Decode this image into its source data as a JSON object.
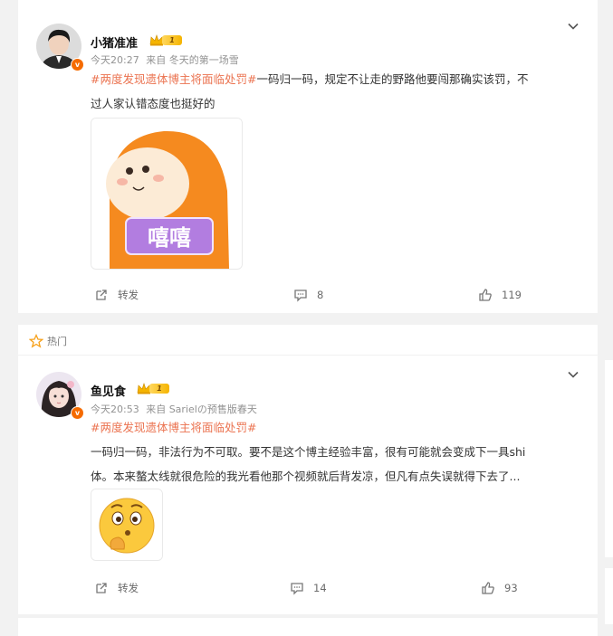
{
  "feed": {
    "hot_label": "热门",
    "posts": [
      {
        "username": "小猪准准",
        "level": "1",
        "time": "今天20:27",
        "source": "来自 冬天的第一场雪",
        "topic": "#两度发现遗体博主将面临处罚#",
        "text_line1_rest": "一码归一码，规定不让走的野路他要闯那确实该罚，不",
        "text_line2": "过人家认错态度也挺好的",
        "image_caption": "嘻嘻",
        "actions": {
          "repost": "转发",
          "comments": "8",
          "likes": "119"
        }
      },
      {
        "username": "鱼见食",
        "level": "1",
        "time": "今天20:53",
        "source": "来自 Sarielの预售版春天",
        "topic": "#两度发现遗体博主将面临处罚#",
        "text_line1": "一码归一码，非法行为不可取。要不是这个博主经验丰富，很有可能就会变成下一具shi",
        "text_line2": "体。本来螯太线就很危险的我光看他那个视频就后背发凉，但凡有点失误就得下去了...",
        "actions": {
          "repost": "转发",
          "comments": "14",
          "likes": "93"
        }
      }
    ]
  },
  "colors": {
    "topic": "#eb7350",
    "badge": "#f56b00",
    "hot_icon": "#f7a11a"
  },
  "icons": [
    "avatar",
    "verified-badge",
    "level-crown-icon",
    "chevron-down-icon",
    "repost-icon",
    "comment-icon",
    "like-icon",
    "hot-star-icon"
  ]
}
